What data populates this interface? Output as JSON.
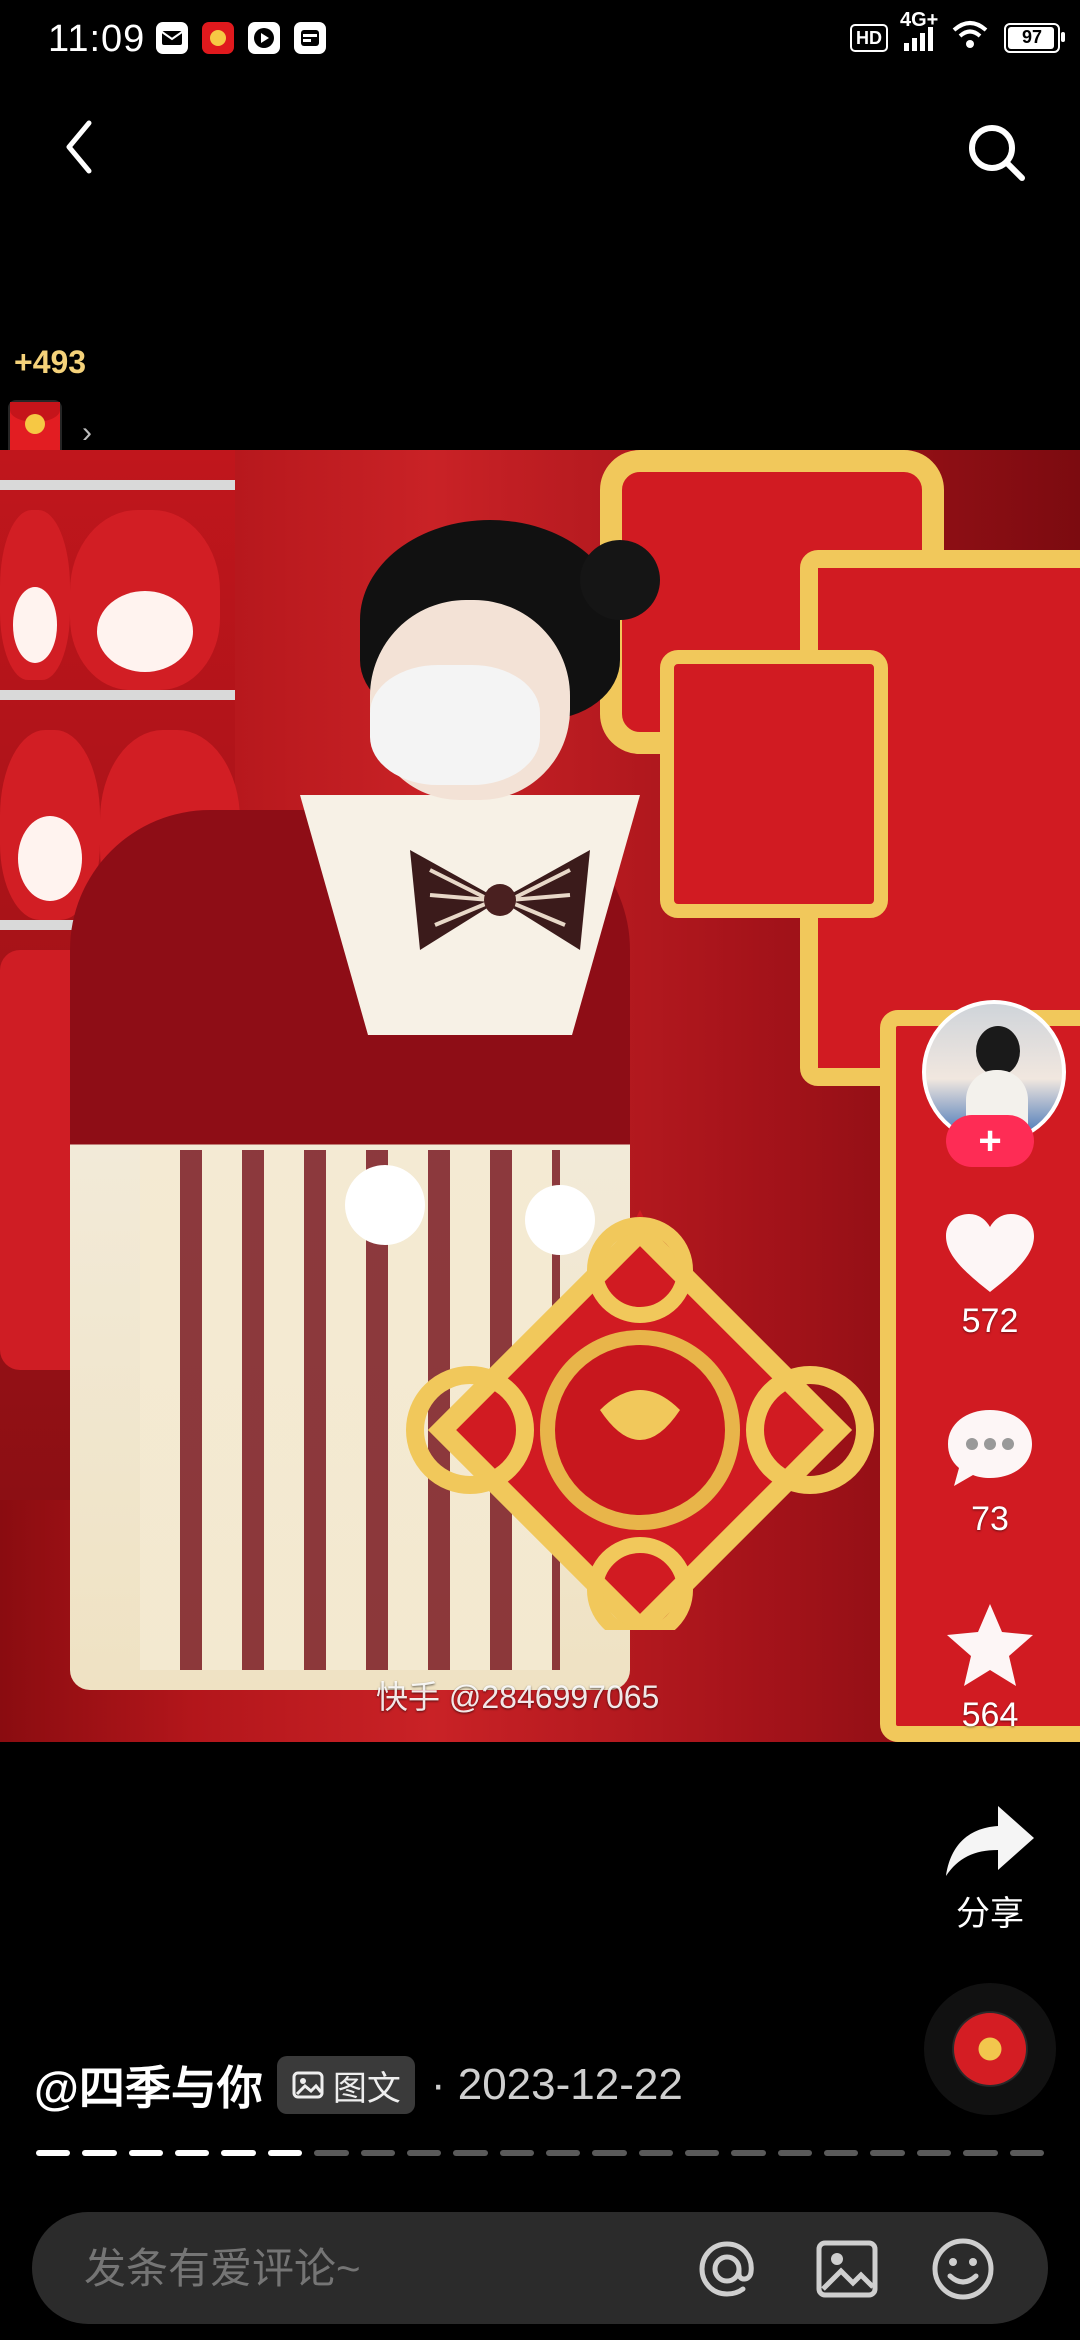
{
  "status": {
    "time": "11:09",
    "hd": "HD",
    "network": "4G+",
    "battery": "97"
  },
  "reward": {
    "count": "+493"
  },
  "photo": {
    "watermark": "快手 @2846997065"
  },
  "actions": {
    "likes": "572",
    "comments": "73",
    "favorites": "564",
    "share_label": "分享"
  },
  "follow": {
    "label": "+"
  },
  "post": {
    "author": "@四季与你",
    "type_badge": "图文",
    "date": "· 2023-12-22"
  },
  "progress": {
    "total": 22,
    "current": 6
  },
  "comment": {
    "placeholder": "发条有爱评论~"
  },
  "icons": {
    "back": "chevron-left-icon",
    "search": "search-icon",
    "like": "heart-icon",
    "comment": "comment-bubble-icon",
    "favorite": "star-icon",
    "share": "share-arrow-icon",
    "mention": "at-icon",
    "image": "image-icon",
    "emoji": "smile-icon"
  }
}
